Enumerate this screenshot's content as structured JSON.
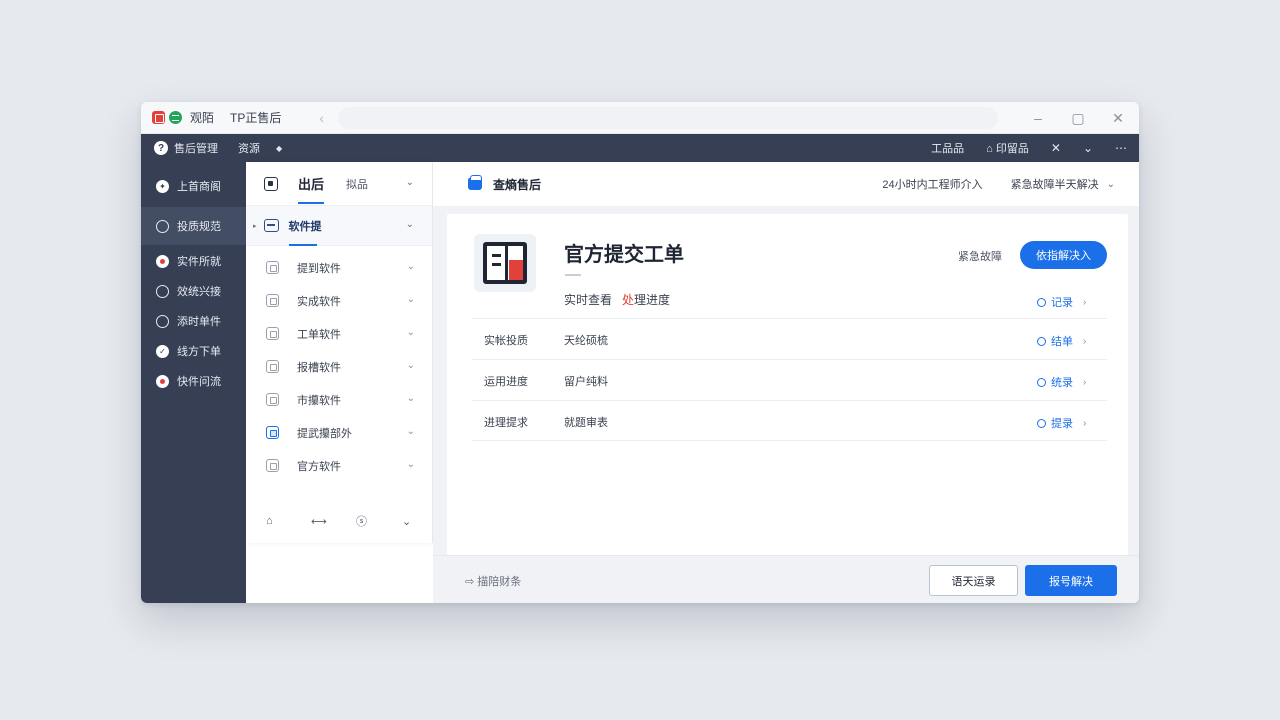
{
  "titlebar": {
    "app_name": "观陌",
    "title": "TP正售后",
    "back": "‹",
    "minimize": "–",
    "restore": "▢",
    "close": "✕"
  },
  "navbar": {
    "help": "?",
    "item1": "售后管理",
    "item2": "资源",
    "dot": "◆",
    "right_item1": "工品品",
    "right_item2": "⌂ 印留品",
    "tools": "✕",
    "chevron": "⌄",
    "more": "⋯"
  },
  "sidebar": {
    "items": [
      {
        "label": "上首商阁",
        "icon": "✦"
      },
      {
        "label": "投质规范"
      },
      {
        "label": "实件所就"
      },
      {
        "label": "效统兴接"
      },
      {
        "label": "添时单件"
      },
      {
        "label": "线方下单",
        "icon": "✓"
      },
      {
        "label": "快件问流"
      }
    ]
  },
  "midpanel": {
    "tab_active": "出后",
    "tab_other": "拟品",
    "chevron": "⌄",
    "selected": {
      "tri": "▸",
      "label": "软件提"
    },
    "rows": [
      {
        "label": "提到软件"
      },
      {
        "label": "实成软件"
      },
      {
        "label": "工单软件"
      },
      {
        "label": "报槽软件"
      },
      {
        "label": "市攥软件"
      },
      {
        "label": "提武攥部外"
      },
      {
        "label": "官方软件"
      }
    ],
    "bottom": [
      "⌂",
      "⟷",
      "ⓢ",
      "⌄"
    ]
  },
  "content": {
    "header": {
      "title": "查熵售后",
      "right1": "24小时内工程师介入",
      "right2": "紧急故障半天解决",
      "chevron": "⌄"
    },
    "card": {
      "title": "官方提交工单",
      "subtitle_prefix": "实时查看",
      "subtitle_highlight": "处",
      "subtitle_suffix": "理进度",
      "urgent_label": "紧急故障",
      "primary_button": "依指解决入",
      "top_action": "记录",
      "rows": [
        {
          "key": "实帐投质",
          "value": "天纶硕梳",
          "action": "结单"
        },
        {
          "key": "运用进度",
          "value": "留户纯料",
          "action": "统录"
        },
        {
          "key": "进理提求",
          "value": "就题审表",
          "action": "提录"
        }
      ],
      "arrow": "›"
    },
    "footer": {
      "left_text": "⇨ 描陪财条",
      "outline_button": "语天运录",
      "solid_button": "报号解决"
    }
  },
  "colors": {
    "accent": "#1b6fe8",
    "sidebar": "#363f54",
    "danger": "#e2403a",
    "success": "#22a55b"
  }
}
